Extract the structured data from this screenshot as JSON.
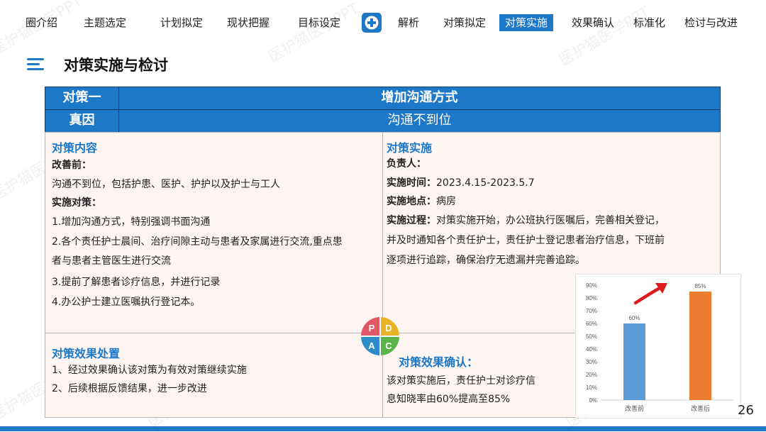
{
  "nav": {
    "items": [
      "圈介绍",
      "主题选定",
      "计划拟定",
      "现状把握",
      "目标设定",
      "解析",
      "对策拟定",
      "对策实施",
      "效果确认",
      "标准化",
      "检讨与改进"
    ],
    "active": "对策实施",
    "icon": "plus-circle-icon"
  },
  "page_title": "对策实施与检讨",
  "table": {
    "row1_label": "对策一",
    "row1_value": "增加沟通方式",
    "row2_label": "真因",
    "row2_value": "沟通不到位"
  },
  "content": {
    "title": "对策内容",
    "before_label": "改善前：",
    "before_text": "沟通不到位，包括护患、医护、护护以及护士与工人",
    "measures_label": "实施对策：",
    "measures": [
      "1.增加沟通方式，特别强调书面沟通",
      "2.各个责任护士晨间、治疗间隙主动与患者及家属进行交流,重点患",
      "者与患者主管医生进行交流",
      "3.提前了解患者诊疗信息，并进行记录",
      "4.办公护士建立医嘱执行登记本。"
    ]
  },
  "implementation": {
    "title": "对策实施",
    "owner_label": "负责人：",
    "owner_value": "",
    "time_label": "实施时间：",
    "time_value": "2023.4.15-2023.5.7",
    "place_label": "实施地点：",
    "place_value": "病房",
    "process_label": "实施过程：",
    "process_lines": [
      "对策实施开始，办公班执行医嘱后，完善相关登记，",
      "并及时通知各个责任护士，责任护士登记患者治疗信息，下班前",
      "逐项进行追踪，确保治疗无遗漏并完善追踪。"
    ]
  },
  "disposal": {
    "title": "对策效果处置",
    "lines": [
      "1、经过效果确认该对策为有效对策继续实施",
      "2、后续根据反馈结果，进一步改进"
    ]
  },
  "confirm": {
    "title": "对策效果确认：",
    "lines": [
      "该对策实施后，责任护士对诊疗信",
      "息知晓率由60%提高至85%"
    ]
  },
  "pdca": [
    "P",
    "D",
    "A",
    "C"
  ],
  "chart_data": {
    "type": "bar",
    "categories": [
      "改善前",
      "改善后"
    ],
    "values": [
      60,
      85
    ],
    "data_labels": [
      "60%",
      "85%"
    ],
    "yticks": [
      "0%",
      "10%",
      "20%",
      "30%",
      "40%",
      "50%",
      "60%",
      "70%",
      "80%",
      "90%"
    ],
    "ylim": [
      0,
      90
    ],
    "colors": [
      "#5b9bd5",
      "#ed7d31"
    ],
    "grid": false,
    "title": "",
    "xlabel": "",
    "ylabel": ""
  },
  "watermark": "医护猫医学PPT",
  "page_number": "26"
}
